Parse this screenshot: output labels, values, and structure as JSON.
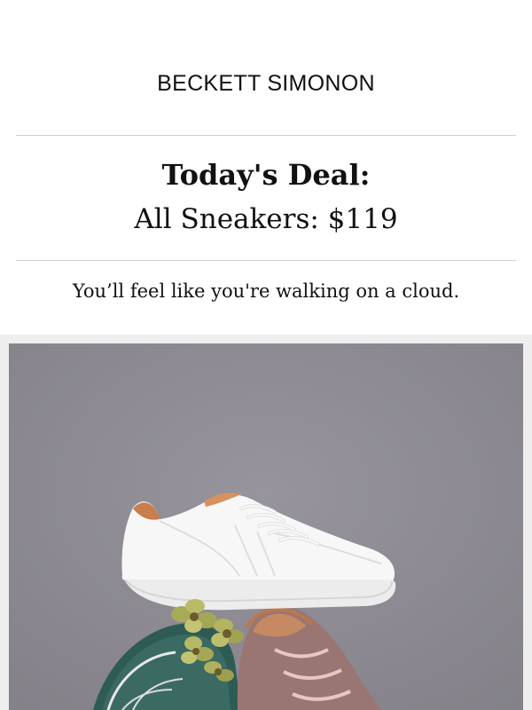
{
  "email": {
    "brand": "BECKETT SIMONON",
    "headline": "Today's Deal:",
    "subheadline": "All Sneakers: $119",
    "tagline": "You’ll feel like you're walking on a cloud."
  },
  "hero": {
    "background_color": "#8d8a93",
    "products": [
      "white-leather-sneaker",
      "green-suede-sneaker",
      "pink-suede-sneaker"
    ],
    "decoration": "yellow-flowers"
  },
  "colors": {
    "text": "#111111",
    "divider": "#cfcfcf",
    "band": "#eeeeee"
  }
}
